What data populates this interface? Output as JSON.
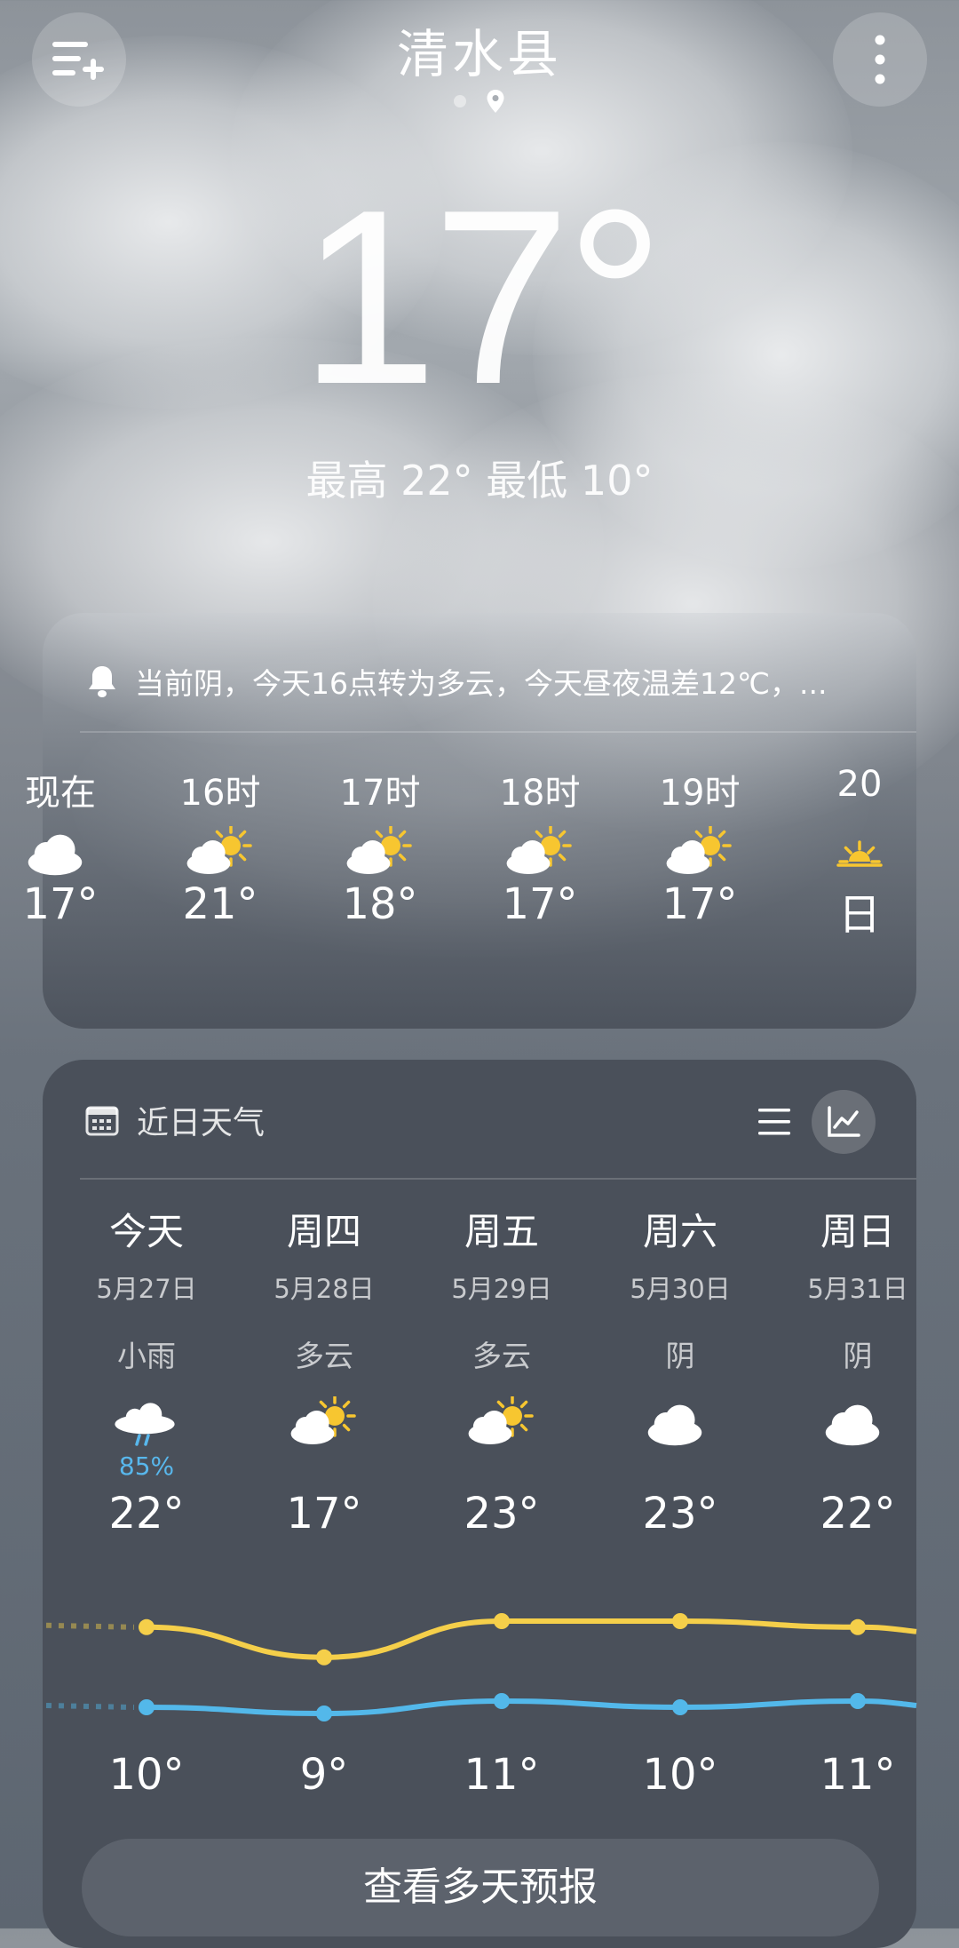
{
  "header": {
    "city": "清水县",
    "current_temp": "17°",
    "hi_lo": "最高 22° 最低 10°"
  },
  "alert": {
    "text": "当前阴，今天16点转为多云，今天昼夜温差12℃，..."
  },
  "hourly": [
    {
      "label": "现在",
      "icon": "cloudy-icon",
      "temp": "17°"
    },
    {
      "label": "16时",
      "icon": "partly-cloudy-icon",
      "temp": "21°"
    },
    {
      "label": "17时",
      "icon": "partly-cloudy-icon",
      "temp": "18°"
    },
    {
      "label": "18时",
      "icon": "partly-cloudy-icon",
      "temp": "17°"
    },
    {
      "label": "19时",
      "icon": "partly-cloudy-icon",
      "temp": "17°"
    },
    {
      "label": "20",
      "icon": "sunset-icon",
      "temp": "日"
    }
  ],
  "daily_section": {
    "title": "近日天气",
    "days": [
      {
        "name": "今天",
        "date": "5月27日",
        "weather": "小雨",
        "icon": "light-rain-icon",
        "precip": "85%",
        "high": "22°",
        "low": "10°",
        "high_val": 22,
        "low_val": 10
      },
      {
        "name": "周四",
        "date": "5月28日",
        "weather": "多云",
        "icon": "partly-cloudy-icon",
        "precip": "",
        "high": "17°",
        "low": "9°",
        "high_val": 17,
        "low_val": 9
      },
      {
        "name": "周五",
        "date": "5月29日",
        "weather": "多云",
        "icon": "partly-cloudy-icon",
        "precip": "",
        "high": "23°",
        "low": "11°",
        "high_val": 23,
        "low_val": 11
      },
      {
        "name": "周六",
        "date": "5月30日",
        "weather": "阴",
        "icon": "cloudy-icon",
        "precip": "",
        "high": "23°",
        "low": "10°",
        "high_val": 23,
        "low_val": 10
      },
      {
        "name": "周日",
        "date": "5月31日",
        "weather": "阴",
        "icon": "cloudy-icon",
        "precip": "",
        "high": "22°",
        "low": "11°",
        "high_val": 22,
        "low_val": 11
      }
    ],
    "button": "查看多天预报"
  },
  "colors": {
    "high_line": "#f5cf4a",
    "low_line": "#53b8ea",
    "sun": "#f7c630",
    "precip": "#58b7ec"
  }
}
